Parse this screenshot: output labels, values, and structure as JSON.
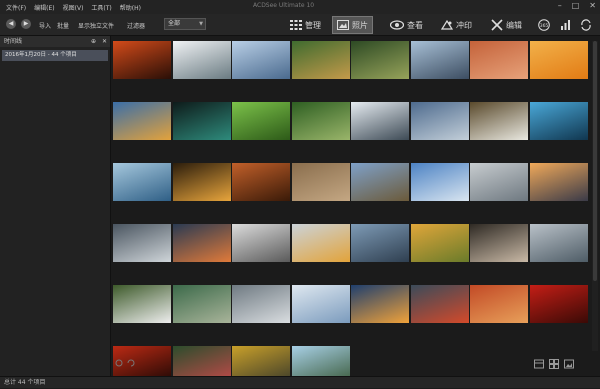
{
  "menu": {
    "file": "文件(F)",
    "edit": "编辑(E)",
    "view": "视图(V)",
    "tools": "工具(T)",
    "help": "帮助(H)"
  },
  "app_title": "ACDSee Ultimate 10",
  "toolbar": {
    "import": "导入",
    "batch": "批量",
    "show_folder": "显示独立文件",
    "filter": "过滤器",
    "filter_value": "全部"
  },
  "modes": {
    "manage": "管理",
    "photos": "照片",
    "view": "查看",
    "develop": "冲印",
    "edit": "编辑",
    "active": "photos"
  },
  "sidebar": {
    "title": "时间线",
    "timeline_item": "2016年1月20日 - 44 个项目"
  },
  "status": "总计 44 个项目",
  "thumbnails": [
    {
      "c1": "#d34b1a",
      "c2": "#2a0f07"
    },
    {
      "c1": "#f0f2f4",
      "c2": "#6a7b82"
    },
    {
      "c1": "#b9cfe6",
      "c2": "#4a6a8e"
    },
    {
      "c1": "#3f6b2f",
      "c2": "#c49a4a"
    },
    {
      "c1": "#2d4a24",
      "c2": "#97a35a"
    },
    {
      "c1": "#a8c0d6",
      "c2": "#3c4d61"
    },
    {
      "c1": "#c4623a",
      "c2": "#e7a27a"
    },
    {
      "c1": "#f2b14a",
      "c2": "#e27b14"
    },
    {
      "c1": "#3a6ea8",
      "c2": "#e3a23c"
    },
    {
      "c1": "#0e1b1a",
      "c2": "#2e8b7c"
    },
    {
      "c1": "#7cc24a",
      "c2": "#2d5a18"
    },
    {
      "c1": "#2e5f22",
      "c2": "#9ab56a"
    },
    {
      "c1": "#e6ecf1",
      "c2": "#3d4a55"
    },
    {
      "c1": "#4e6b8e",
      "c2": "#c3cfd9"
    },
    {
      "c1": "#5a4a2c",
      "c2": "#e9e8e0"
    },
    {
      "c1": "#4aa8d8",
      "c2": "#10364f"
    },
    {
      "c1": "#a6c8dd",
      "c2": "#2f5f86"
    },
    {
      "c1": "#2b1d0c",
      "c2": "#e8a53c"
    },
    {
      "c1": "#c2602a",
      "c2": "#3a1a08"
    },
    {
      "c1": "#8a6e4d",
      "c2": "#c4a783"
    },
    {
      "c1": "#7fa1c9",
      "c2": "#6b5a3a"
    },
    {
      "c1": "#4d83c4",
      "c2": "#d9e5f0"
    },
    {
      "c1": "#c7cccf",
      "c2": "#6e7880"
    },
    {
      "c1": "#f0a95a",
      "c2": "#3a3a48"
    },
    {
      "c1": "#4a5560",
      "c2": "#cfd5d9"
    },
    {
      "c1": "#2a3a52",
      "c2": "#e07a3a"
    },
    {
      "c1": "#dcdcdc",
      "c2": "#5a5a5a"
    },
    {
      "c1": "#cbd3d9",
      "c2": "#e2a33a"
    },
    {
      "c1": "#7e9bb6",
      "c2": "#2f3f50"
    },
    {
      "c1": "#e0a63a",
      "c2": "#6a7b2a"
    },
    {
      "c1": "#2f2a24",
      "c2": "#c9b9a6"
    },
    {
      "c1": "#b9c1c8",
      "c2": "#4e5c66"
    },
    {
      "c1": "#3d5a2a",
      "c2": "#eeeeee"
    },
    {
      "c1": "#3c6a4a",
      "c2": "#a9b49a"
    },
    {
      "c1": "#6f7a82",
      "c2": "#d9dde0"
    },
    {
      "c1": "#dfe8f0",
      "c2": "#7b9bbd"
    },
    {
      "c1": "#1f3f6e",
      "c2": "#f0a23a"
    },
    {
      "c1": "#3b4b5a",
      "c2": "#d44a2a"
    },
    {
      "c1": "#c24a26",
      "c2": "#e8a05a"
    },
    {
      "c1": "#c41e16",
      "c2": "#3a0a06"
    },
    {
      "c1": "#bc2a14",
      "c2": "#1a0704"
    },
    {
      "c1": "#2c4d2c",
      "c2": "#c44a4a"
    },
    {
      "c1": "#c9a02a",
      "c2": "#3a3a2a"
    },
    {
      "c1": "#a8d0e6",
      "c2": "#3a5a3a"
    }
  ]
}
